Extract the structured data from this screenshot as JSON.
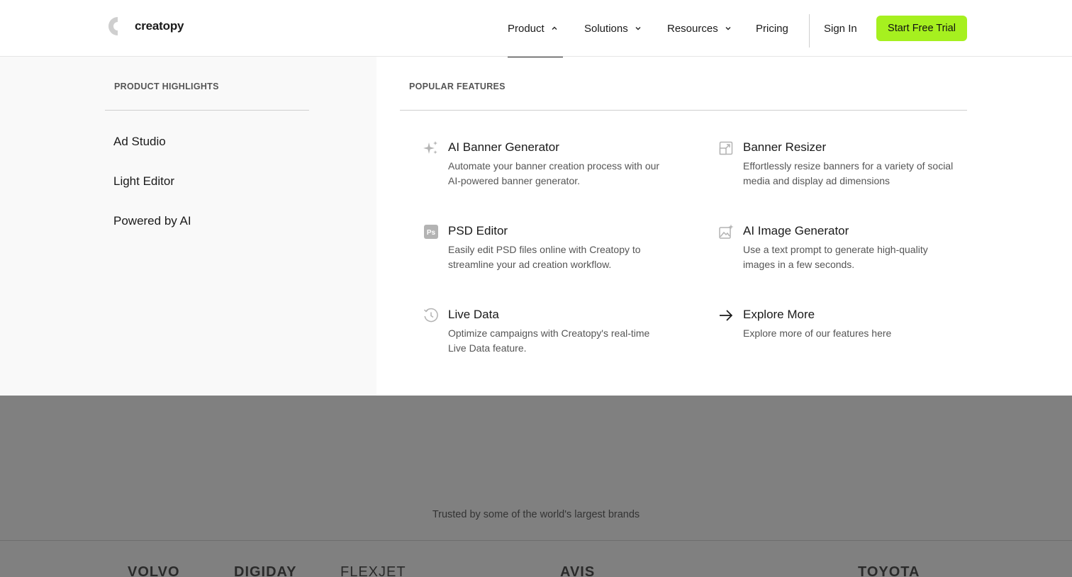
{
  "header": {
    "logo_text": "creatopy",
    "nav": [
      {
        "label": "Product"
      },
      {
        "label": "Solutions"
      },
      {
        "label": "Resources"
      },
      {
        "label": "Pricing"
      }
    ],
    "sign_in": "Sign In",
    "cta": "Start Free Trial"
  },
  "menu": {
    "highlights_heading": "PRODUCT HIGHLIGHTS",
    "highlights": [
      "Ad Studio",
      "Light Editor",
      "Powered by AI"
    ],
    "features_heading": "POPULAR FEATURES",
    "features": [
      {
        "title": "AI Banner Generator",
        "desc": "Automate your banner creation process with our AI-powered banner generator.",
        "icon": "sparkles-icon"
      },
      {
        "title": "Banner Resizer",
        "desc": "Effortlessly resize banners for a variety of social media and display ad dimensions",
        "icon": "resize-icon"
      },
      {
        "title": "PSD Editor",
        "desc": "Easily edit PSD files online with Creatopy to streamline your ad creation workflow.",
        "icon": "ps-icon",
        "icon_text": "Ps"
      },
      {
        "title": "AI Image Generator",
        "desc": "Use a text prompt to generate high-quality images in a few seconds.",
        "icon": "image-sparkle-icon"
      },
      {
        "title": "Live Data",
        "desc": "Optimize campaigns with Creatopy's real-time Live Data feature.",
        "icon": "history-icon"
      },
      {
        "title": "Explore More",
        "desc": "Explore more of our features here",
        "icon": "arrow-right-icon"
      }
    ]
  },
  "trusted_text": "Trusted by some of the world's largest brands",
  "brands": [
    "VOLVO",
    "DIGIDAY",
    "FLEXJET",
    "AVIS",
    "TOYOTA"
  ],
  "colors": {
    "accent": "#a6f01f",
    "overlay": "#808080",
    "panel": "#f9f9f9"
  }
}
